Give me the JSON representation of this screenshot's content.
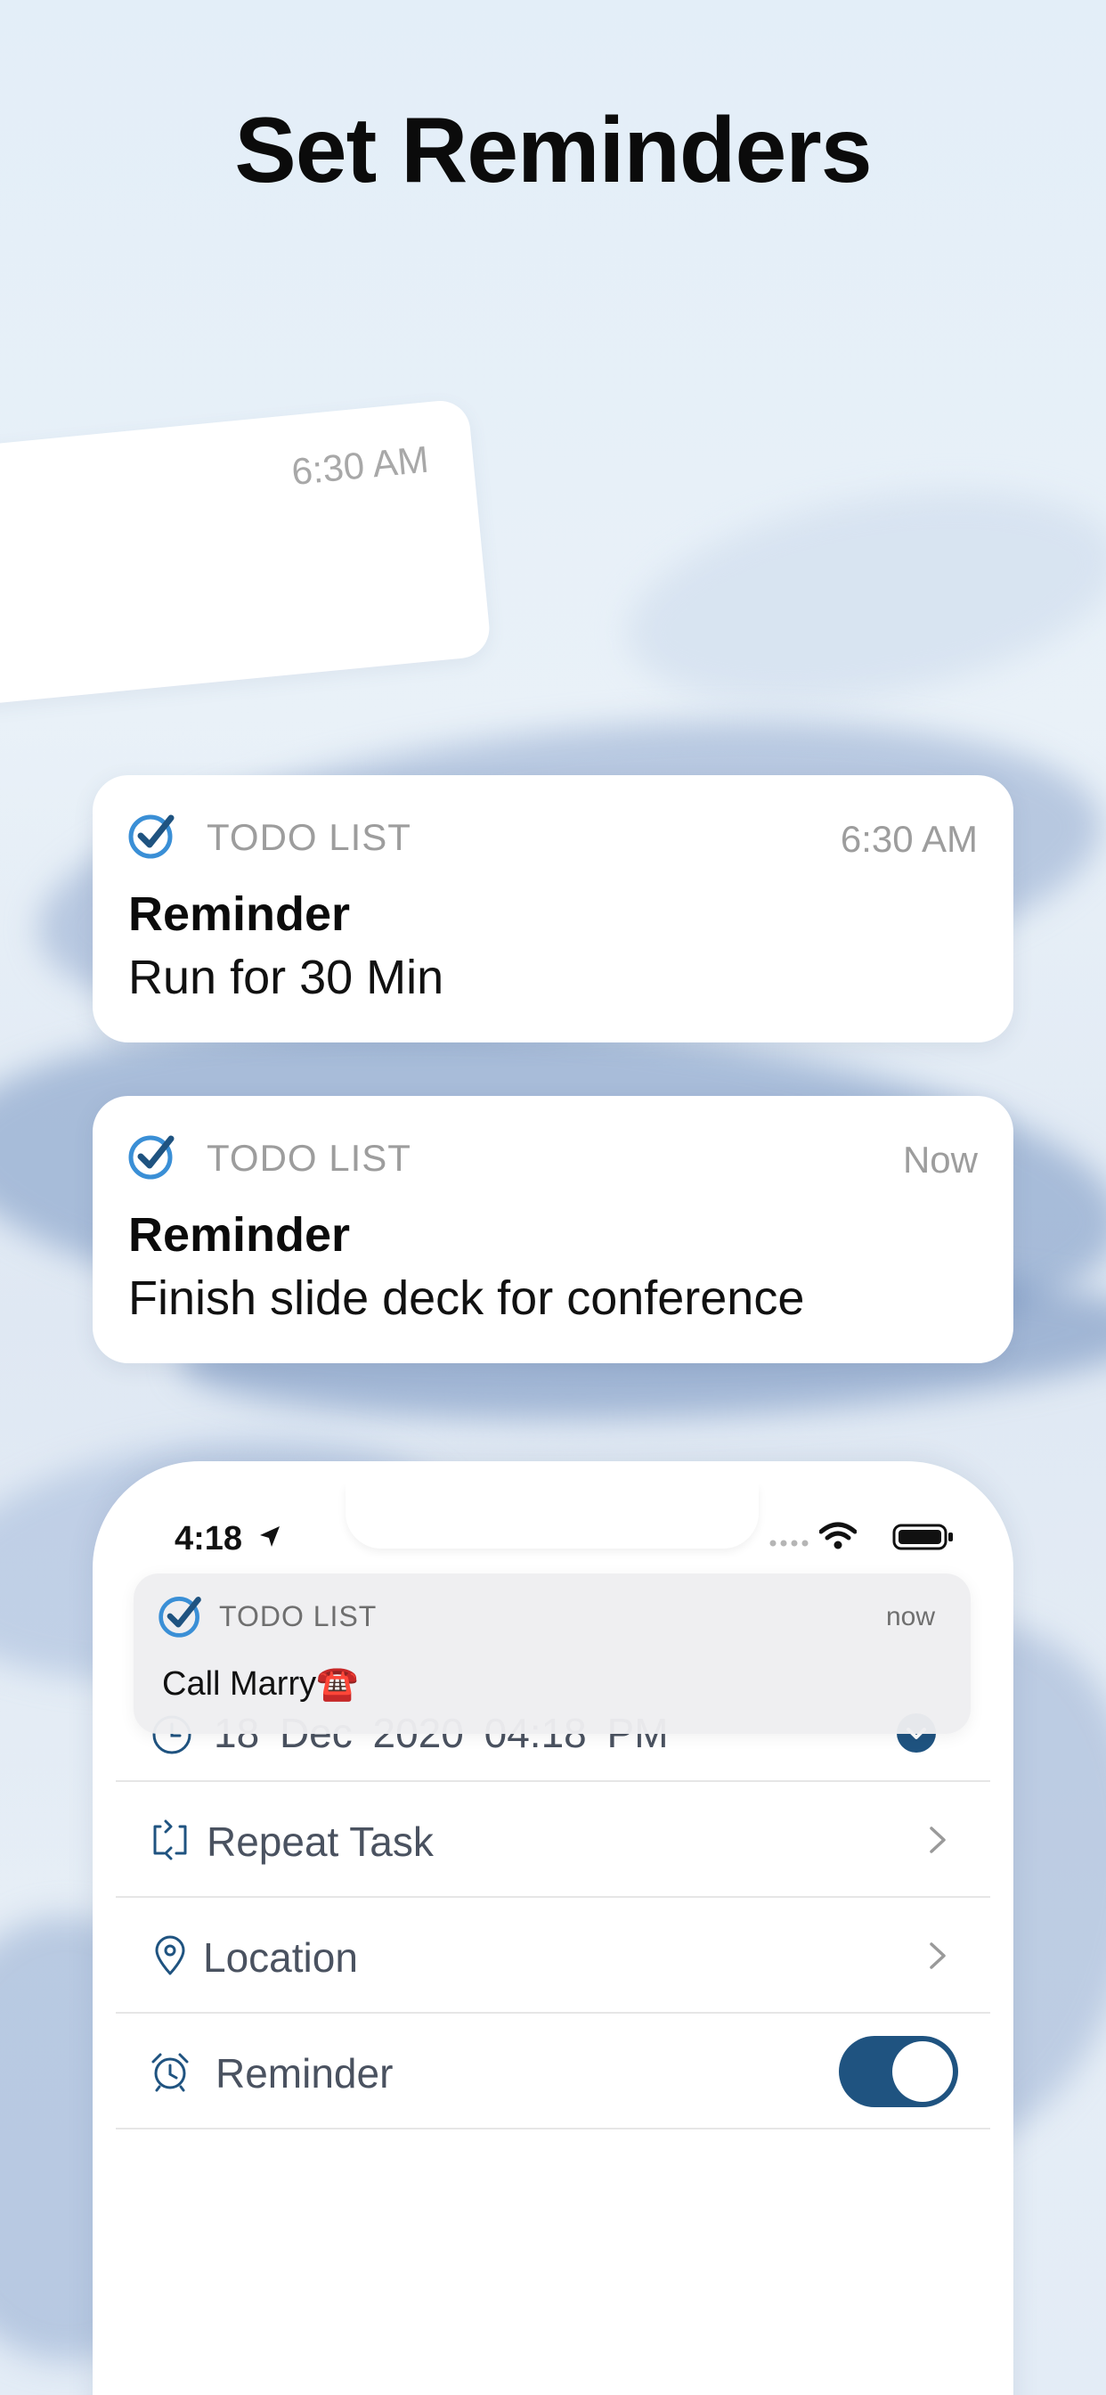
{
  "page": {
    "title": "Set Reminders"
  },
  "tilted_card": {
    "time": "6:30 AM"
  },
  "notifications": [
    {
      "app_name": "TODO LIST",
      "time": "6:30 AM",
      "title": "Reminder",
      "body": "Run for 30 Min"
    },
    {
      "app_name": "TODO LIST",
      "time": "Now",
      "title": "Reminder",
      "body": "Finish slide deck for conference"
    }
  ],
  "phone": {
    "status_bar": {
      "time": "4:18"
    },
    "banner": {
      "app_name": "TODO LIST",
      "time": "now",
      "body": "Call Marry☎️"
    },
    "date_row": {
      "text": "18 Dec 2020 04:18 PM"
    },
    "rows": [
      {
        "label": "Repeat Task",
        "icon": "repeat-icon"
      },
      {
        "label": "Location",
        "icon": "location-pin-icon"
      },
      {
        "label": "Reminder",
        "icon": "alarm-clock-icon",
        "toggle_on": true
      }
    ]
  },
  "colors": {
    "accent": "#1f5380",
    "icon_blue": "#3a8fd6",
    "text_gray": "#4a5260"
  }
}
